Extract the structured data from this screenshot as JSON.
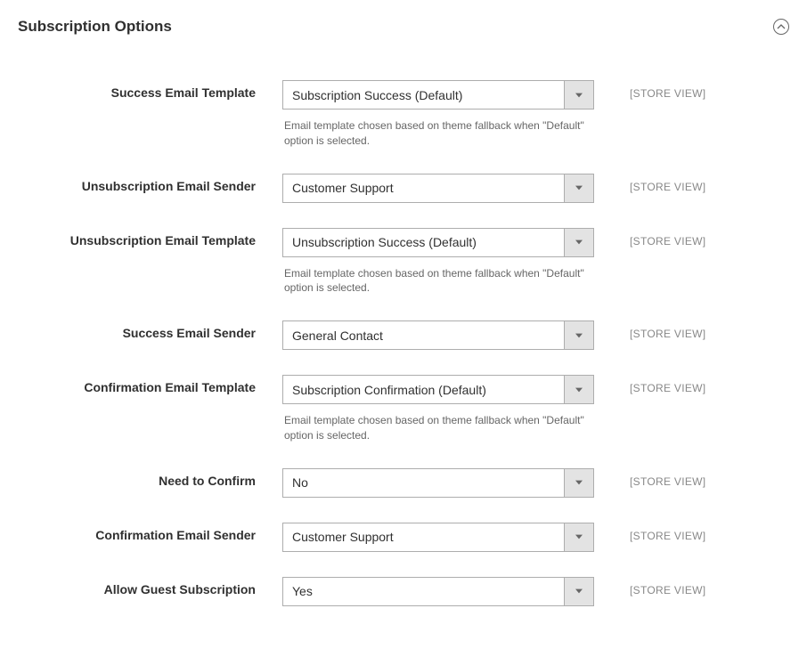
{
  "section": {
    "title": "Subscription Options"
  },
  "fields": {
    "success_email_template": {
      "label": "Success Email Template",
      "value": "Subscription Success (Default)",
      "hint": "Email template chosen based on theme fallback when \"Default\" option is selected.",
      "scope": "[STORE VIEW]"
    },
    "unsubscription_email_sender": {
      "label": "Unsubscription Email Sender",
      "value": "Customer Support",
      "scope": "[STORE VIEW]"
    },
    "unsubscription_email_template": {
      "label": "Unsubscription Email Template",
      "value": "Unsubscription Success (Default)",
      "hint": "Email template chosen based on theme fallback when \"Default\" option is selected.",
      "scope": "[STORE VIEW]"
    },
    "success_email_sender": {
      "label": "Success Email Sender",
      "value": "General Contact",
      "scope": "[STORE VIEW]"
    },
    "confirmation_email_template": {
      "label": "Confirmation Email Template",
      "value": "Subscription Confirmation (Default)",
      "hint": "Email template chosen based on theme fallback when \"Default\" option is selected.",
      "scope": "[STORE VIEW]"
    },
    "need_to_confirm": {
      "label": "Need to Confirm",
      "value": "No",
      "scope": "[STORE VIEW]"
    },
    "confirmation_email_sender": {
      "label": "Confirmation Email Sender",
      "value": "Customer Support",
      "scope": "[STORE VIEW]"
    },
    "allow_guest_subscription": {
      "label": "Allow Guest Subscription",
      "value": "Yes",
      "scope": "[STORE VIEW]"
    }
  }
}
